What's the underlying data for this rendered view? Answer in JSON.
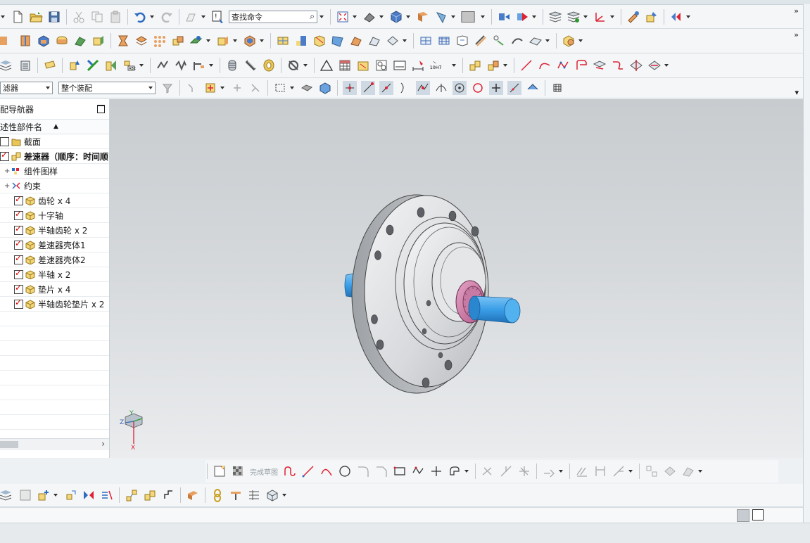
{
  "toolbar": {
    "command_search_placeholder": "查找命令",
    "selection_filter": "滤器",
    "assembly_scope": "整个装配",
    "more_glyph": "»",
    "tolerance_label": "10H7"
  },
  "navigator": {
    "title": "配导航器",
    "column_header": "述性部件名",
    "rows": [
      {
        "label": "截面",
        "kind": "folder",
        "checked": false,
        "expander": "",
        "bold": false
      },
      {
        "label": "差速器（顺序：时间顺",
        "kind": "assembly",
        "checked": true,
        "expander": "",
        "bold": true
      },
      {
        "label": "组件图样",
        "kind": "pattern",
        "checked": null,
        "expander": "+",
        "bold": false
      },
      {
        "label": "约束",
        "kind": "constraint",
        "checked": null,
        "expander": "+",
        "bold": false
      },
      {
        "label": "齿轮 x 4",
        "kind": "part",
        "checked": true,
        "expander": "",
        "bold": false
      },
      {
        "label": "十字轴",
        "kind": "part",
        "checked": true,
        "expander": "",
        "bold": false
      },
      {
        "label": "半轴齿轮 x 2",
        "kind": "part",
        "checked": true,
        "expander": "",
        "bold": false
      },
      {
        "label": "差速器壳体1",
        "kind": "part",
        "checked": true,
        "expander": "",
        "bold": false
      },
      {
        "label": "差速器壳体2",
        "kind": "part",
        "checked": true,
        "expander": "",
        "bold": false
      },
      {
        "label": "半轴 x 2",
        "kind": "part",
        "checked": true,
        "expander": "",
        "bold": false
      },
      {
        "label": "垫片 x 4",
        "kind": "part",
        "checked": true,
        "expander": "",
        "bold": false
      },
      {
        "label": "半轴齿轮垫片 x 2",
        "kind": "part",
        "checked": true,
        "expander": "",
        "bold": false
      }
    ],
    "scroll_arrow": "›"
  },
  "sketch_toolbar": {
    "finish_sketch_label": "完成草图"
  },
  "triad": {
    "x": "X",
    "y": "Y",
    "z": "Z"
  },
  "colors": {
    "flange": "#d9dadc",
    "shaft": "#3a9ee8",
    "gear": "#d07aa8",
    "check": "#d20000",
    "folder": "#e8c65a"
  }
}
